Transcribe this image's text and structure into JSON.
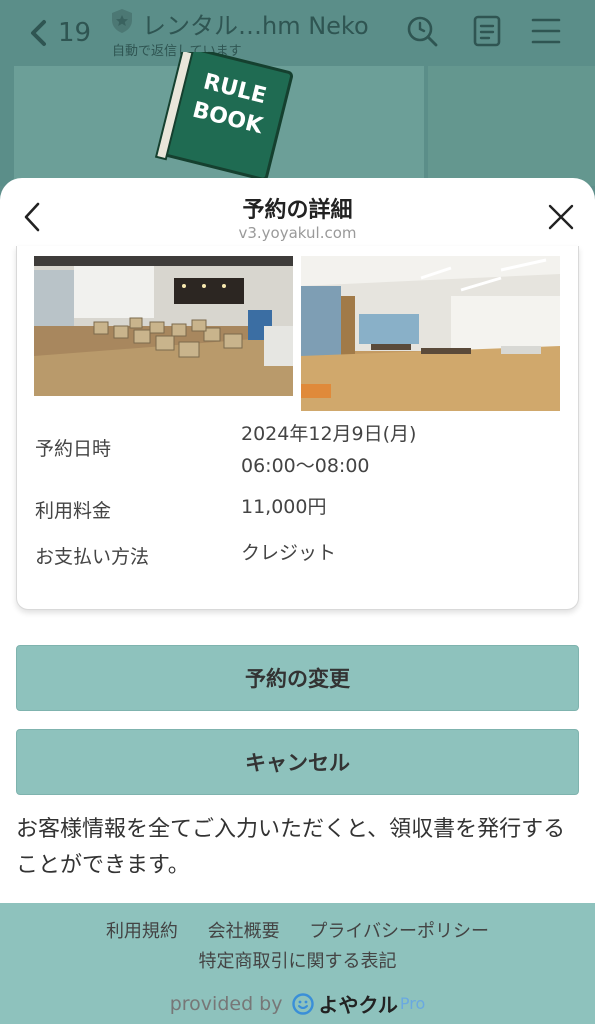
{
  "header": {
    "back_count": "19",
    "title": "レンタル…hm Neko",
    "subtitle": "自動で返信しています",
    "icons": [
      "search-icon",
      "notes-icon",
      "menu-icon"
    ]
  },
  "background": {
    "book_line1": "RULE",
    "book_line2": "BOOK"
  },
  "sheet": {
    "title": "予約の詳細",
    "url": "v3.yoyakul.com"
  },
  "reservation": {
    "datetime_label": "予約日時",
    "date": "2024年12月9日(月)",
    "time": "06:00〜08:00",
    "fee_label": "利用料金",
    "fee": "11,000円",
    "payment_label": "お支払い方法",
    "payment": "クレジット"
  },
  "actions": {
    "change_label": "予約の変更",
    "cancel_label": "キャンセル"
  },
  "note": "お客様情報を全てご入力いただくと、領収書を発行することができます。",
  "footer": {
    "terms": "利用規約",
    "company": "会社概要",
    "privacy": "プライバシーポリシー",
    "commerce": "特定商取引に関する表記",
    "provided_by": "provided by",
    "brand": "よやクル",
    "brand_suffix": "Pro"
  },
  "colors": {
    "accent": "#8ec2bd",
    "overlay_header": "#5b8e89",
    "book_green": "#1f6b52"
  }
}
